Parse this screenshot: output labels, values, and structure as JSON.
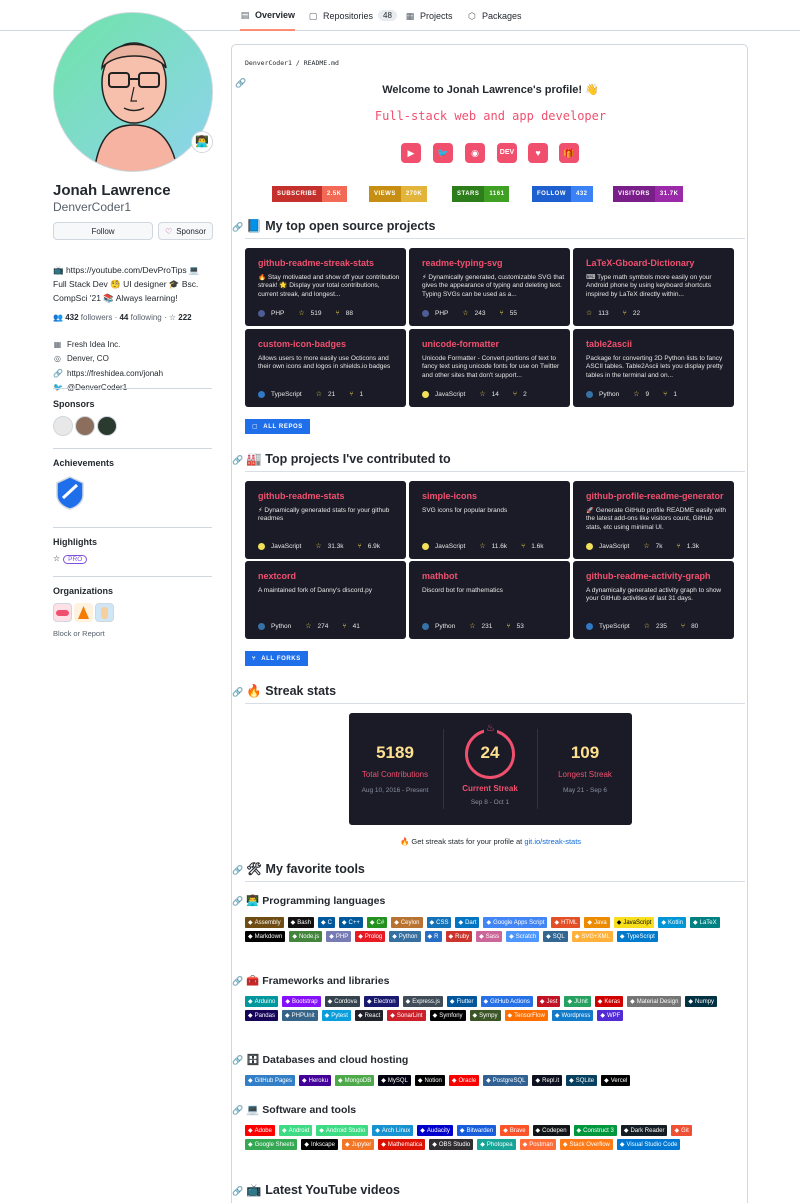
{
  "nav": {
    "tabs": [
      {
        "label": "Overview",
        "icon": "book-icon"
      },
      {
        "label": "Repositories",
        "icon": "repo-icon",
        "count": "48"
      },
      {
        "label": "Projects",
        "icon": "project-icon"
      },
      {
        "label": "Packages",
        "icon": "package-icon"
      }
    ]
  },
  "profile": {
    "name": "Jonah Lawrence",
    "login": "DenverCoder1",
    "follow_label": "Follow",
    "sponsor_label": "Sponsor",
    "bio_line1": "📺 https://youtube.com/DevProTips 💻",
    "bio_line2": "Full Stack Dev 🧐 UI designer 🎓 Bsc.",
    "bio_line3": "CompSci '21 📚 Always learning!",
    "followers_count": "432",
    "followers_label": "followers",
    "following_count": "44",
    "following_label": "following",
    "stars_count": "222",
    "company": "Fresh Idea Inc.",
    "location": "Denver, CO",
    "website": "https://freshidea.com/jonah",
    "twitter": "@DenverCoder1"
  },
  "sidebar": {
    "sponsors_title": "Sponsors",
    "achievements_title": "Achievements",
    "highlights_title": "Highlights",
    "highlights_pro": "PRO",
    "organizations_title": "Organizations",
    "block_report": "Block or Report"
  },
  "readme": {
    "path_user": "DenverCoder1",
    "path_sep": "/",
    "path_file": "README.md",
    "welcome": "Welcome to Jonah Lawrence's profile! 👋",
    "typing": "Full-stack web and app developer",
    "social": [
      {
        "icon": "youtube-icon",
        "glyph": "▶"
      },
      {
        "icon": "twitter-icon",
        "glyph": "🐦"
      },
      {
        "icon": "discord-icon",
        "glyph": "◉"
      },
      {
        "icon": "dev-icon",
        "glyph": "DEV"
      },
      {
        "icon": "kofi-icon",
        "glyph": "♥"
      },
      {
        "icon": "gift-icon",
        "glyph": "🎁"
      }
    ],
    "shields": [
      {
        "label": "SUBSCRIBE",
        "value": "2.5K"
      },
      {
        "label": "VIEWS",
        "value": "270K"
      },
      {
        "label": "STARS",
        "value": "1161"
      },
      {
        "label": "FOLLOW",
        "value": "432"
      },
      {
        "label": "VISITORS",
        "value": "31.7K"
      }
    ],
    "sec_projects": "📘 My top open source projects",
    "projects": [
      {
        "name": "github-readme-streak-stats",
        "desc": "🔥 Stay motivated and show off your contribution streak! 🌟 Display your total contributions, current streak, and longest...",
        "lang": "PHP",
        "stars": "519",
        "forks": "88"
      },
      {
        "name": "readme-typing-svg",
        "desc": "⚡ Dynamically generated, customizable SVG that gives the appearance of typing and deleting text. Typing SVGs can be used as a...",
        "lang": "PHP",
        "stars": "243",
        "forks": "55"
      },
      {
        "name": "LaTeX-Gboard-Dictionary",
        "desc": "⌨ Type math symbols more easily on your Android phone by using keyboard shortcuts inspired by LaTeX directly within...",
        "lang": "",
        "stars": "113",
        "forks": "22"
      },
      {
        "name": "custom-icon-badges",
        "desc": "Allows users to more easily use Octicons and their own icons and logos in shields.io badges",
        "lang": "TypeScript",
        "stars": "21",
        "forks": "1"
      },
      {
        "name": "unicode-formatter",
        "desc": "Unicode Formatter - Convert portions of text to fancy text using unicode fonts for use on Twitter and other sites that don't support...",
        "lang": "JavaScript",
        "stars": "14",
        "forks": "2"
      },
      {
        "name": "table2ascii",
        "desc": "Package for converting 2D Python lists to fancy ASCII tables. Table2Ascii lets you display pretty tables in the terminal and on...",
        "lang": "Python",
        "stars": "9",
        "forks": "1"
      }
    ],
    "all_repos": "ALL REPOS",
    "sec_contrib": "🏭 Top projects I've contributed to",
    "contrib": [
      {
        "name": "github-readme-stats",
        "desc": "⚡ Dynamically generated stats for your github readmes",
        "lang": "JavaScript",
        "stars": "31.3k",
        "forks": "6.9k"
      },
      {
        "name": "simple-icons",
        "desc": "SVG icons for popular brands",
        "lang": "JavaScript",
        "stars": "11.6k",
        "forks": "1.6k"
      },
      {
        "name": "github-profile-readme-generator",
        "desc": "🚀 Generate GitHub profile README easily with the latest add-ons like visitors count, GitHub stats, etc using minimal UI.",
        "lang": "JavaScript",
        "stars": "7k",
        "forks": "1.3k"
      },
      {
        "name": "nextcord",
        "desc": "A maintained fork of Danny's discord.py",
        "lang": "Python",
        "stars": "274",
        "forks": "41"
      },
      {
        "name": "mathbot",
        "desc": "Discord bot for mathematics",
        "lang": "Python",
        "stars": "231",
        "forks": "53"
      },
      {
        "name": "github-readme-activity-graph",
        "desc": "A dynamically generated activity graph to show your GitHub activities of last 31 days.",
        "lang": "TypeScript",
        "stars": "235",
        "forks": "80"
      }
    ],
    "all_forks": "ALL FORKS",
    "sec_streak": "🔥 Streak stats",
    "streak": {
      "total": "5189",
      "total_label": "Total Contributions",
      "total_range": "Aug 10, 2016 - Present",
      "current": "24",
      "current_label": "Current Streak",
      "current_range": "Sep 8 - Oct 1",
      "longest": "109",
      "longest_label": "Longest Streak",
      "longest_range": "May 21 - Sep 6"
    },
    "streak_note": "🔥 Get streak stats for your profile at ",
    "streak_link": "git.io/streak-stats",
    "sec_tools": "🛠 My favorite tools",
    "sec_lang": "👨‍💻 Programming languages",
    "sec_frameworks": "🧰 Frameworks and libraries",
    "sec_db": "🗄 Databases and cloud hosting",
    "sec_software": "💻 Software and tools",
    "sec_youtube": "📺 Latest YouTube videos",
    "languages": [
      "Assembly",
      "Bash",
      "C",
      "C++",
      "C#",
      "Ceylon",
      "CSS",
      "Dart",
      "Google Apps Script",
      "HTML",
      "Java",
      "JavaScript",
      "Kotlin",
      "LaTeX",
      "Markdown",
      "Node.js",
      "PHP",
      "Prolog",
      "Python",
      "R",
      "Ruby",
      "Sass",
      "Scratch",
      "SQL",
      "SVG+XML",
      "TypeScript"
    ],
    "frameworks": [
      "Arduino",
      "Bootstrap",
      "Cordova",
      "Electron",
      "Express.js",
      "Flutter",
      "GitHub Actions",
      "Jest",
      "JUnit",
      "Keras",
      "Material Design",
      "Numpy",
      "Pandas",
      "PHPUnit",
      "Pytest",
      "React",
      "SonarLint",
      "Symfony",
      "Sympy",
      "TensorFlow",
      "Wordpress",
      "WPF"
    ],
    "databases": [
      "GitHub Pages",
      "Heroku",
      "MongoDB",
      "MySQL",
      "Notion",
      "Oracle",
      "PostgreSQL",
      "Repl.it",
      "SQLite",
      "Vercel"
    ],
    "software": [
      "Adobe",
      "Android",
      "Android Studio",
      "Arch Linux",
      "Audacity",
      "Bitwarden",
      "Brave",
      "Codepen",
      "Construct 3",
      "Dark Reader",
      "Git",
      "Google Sheets",
      "Inkscape",
      "Jupyter",
      "Mathematica",
      "OBS Studio",
      "Photopea",
      "Postman",
      "Stack Overflow",
      "Visual Studio Code"
    ]
  },
  "colors": {
    "card_bg": "#1a1b27",
    "accent_pink": "#f0506e",
    "accent_yellow": "#ffe08f",
    "link_blue": "#0969da"
  }
}
